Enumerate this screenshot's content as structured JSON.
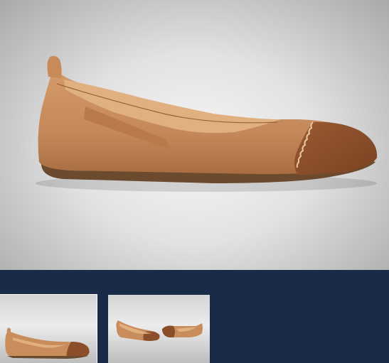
{
  "viewer": {
    "main_image": "product-shoe-side-view",
    "background_color": "#d9d9d9"
  },
  "thumbnails": {
    "items": [
      {
        "image": "shoe-side-view-thumbnail",
        "selected": true
      },
      {
        "image": "shoe-pair-thumbnail",
        "selected": false
      }
    ],
    "strip_color": "#1a2b4a"
  },
  "colors": {
    "leather": "#c98d5c",
    "leather_dark": "#a66a3e",
    "suede_toe": "#8b4e2b",
    "sole": "#6b4a2e",
    "lining": "#d9a97a"
  }
}
